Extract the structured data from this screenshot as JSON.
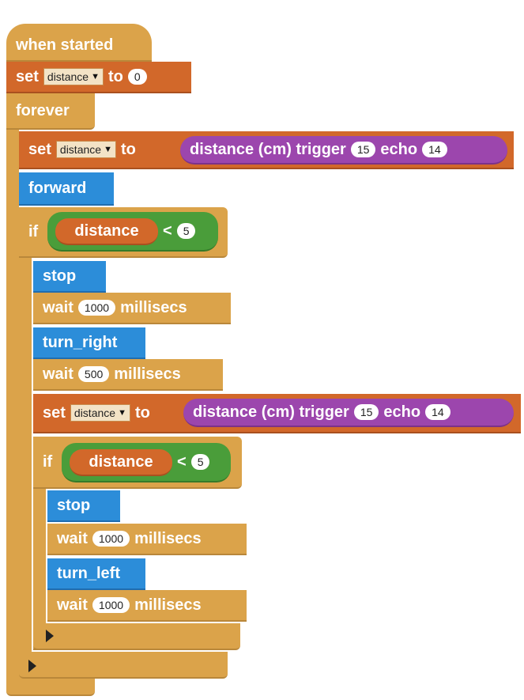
{
  "program": {
    "when_started": "when started",
    "set_initial": {
      "set": "set",
      "var": "distance",
      "to": "to",
      "value": "0"
    },
    "forever": "forever",
    "set_distance_1": {
      "set": "set",
      "var": "distance",
      "to": "to",
      "sensor": "distance (cm) trigger",
      "trigger": "15",
      "echo": "echo",
      "echo_value": "14"
    },
    "forward": "forward",
    "if_1": {
      "if": "if",
      "var": "distance",
      "op": "<",
      "value": "5"
    },
    "stop_1": "stop",
    "wait_1": {
      "wait": "wait",
      "value": "1000",
      "unit": "millisecs"
    },
    "turn_right": "turn_right",
    "wait_2": {
      "wait": "wait",
      "value": "500",
      "unit": "millisecs"
    },
    "set_distance_2": {
      "set": "set",
      "var": "distance",
      "to": "to",
      "sensor": "distance (cm) trigger",
      "trigger": "15",
      "echo": "echo",
      "echo_value": "14"
    },
    "if_2": {
      "if": "if",
      "var": "distance",
      "op": "<",
      "value": "5"
    },
    "stop_2": "stop",
    "wait_3": {
      "wait": "wait",
      "value": "1000",
      "unit": "millisecs"
    },
    "turn_left": "turn_left",
    "wait_4": {
      "wait": "wait",
      "value": "1000",
      "unit": "millisecs"
    }
  },
  "colors": {
    "control": "#dba34a",
    "variable": "#d2682a",
    "movement": "#2c8dd9",
    "sensor": "#9c46ad",
    "logic": "#4a9d3a"
  }
}
